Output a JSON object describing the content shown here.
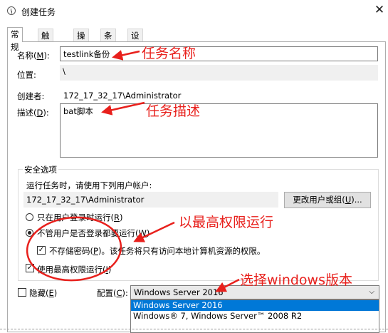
{
  "window": {
    "title": "创建任务",
    "close": "✕"
  },
  "tabs": [
    "常规",
    "触发器",
    "操作",
    "条件",
    "设置"
  ],
  "general": {
    "name_label": "名称(M):",
    "name_value": "testlink备份",
    "location_label": "位置:",
    "location_value": "\\",
    "author_label": "创建者:",
    "author_value": "172_17_32_17\\Administrator",
    "desc_label": "描述(D):",
    "desc_value": "bat脚本"
  },
  "security": {
    "group_label": "安全选项",
    "run_as_label": "运行任务时，请使用下列用户帐户:",
    "account_value": "172_17_32_17\\Administrator",
    "change_button": "更改用户或组(U)...",
    "radio_logged_on": "只在用户登录时运行(R)",
    "radio_whether": "不管用户是否登录都要运行(W)",
    "no_store_password": "不存储密码(P)。该任务将只有访问本地计算机资源的权限。",
    "highest_privileges": "使用最高权限运行(I)"
  },
  "bottom": {
    "hidden_label": "隐藏(E)",
    "configure_label": "配置(C):",
    "configure_value": "Windows Server 2016",
    "options": [
      "Windows Server 2016",
      "Windows® 7, Windows Server™ 2008 R2"
    ]
  },
  "annotations": {
    "task_name": "任务名称",
    "task_desc": "任务描述",
    "highest": "以最高权限运行",
    "choose_version": "选择windows版本"
  },
  "colors": {
    "annotation": "#e8201c",
    "selection": "#0078d7"
  }
}
